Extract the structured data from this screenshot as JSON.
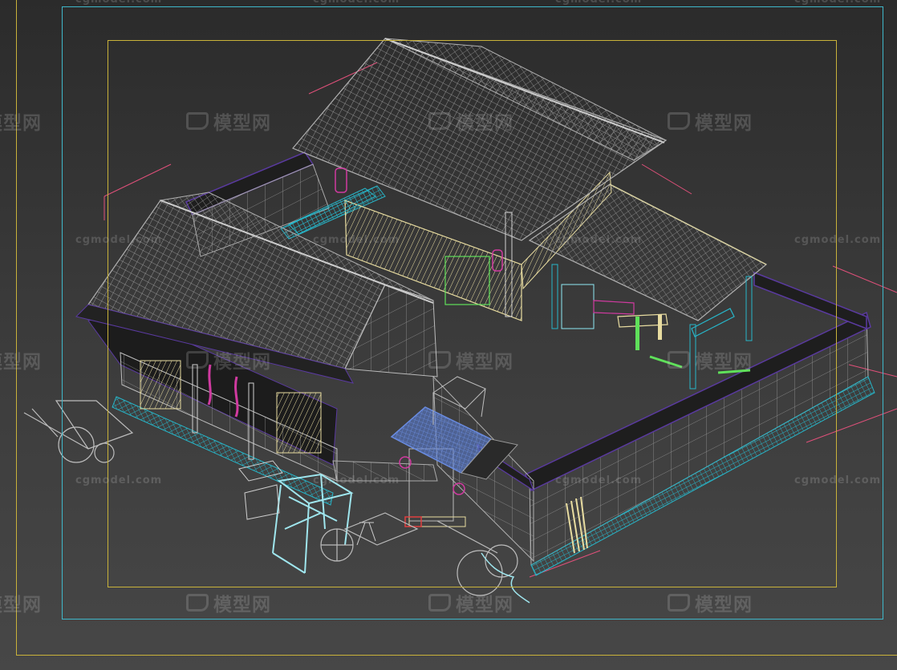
{
  "viewport": {
    "name": "3ds-max-perspective-viewport",
    "view_mode": "wireframe",
    "background": "#3a3a3a"
  },
  "safe_frames": {
    "outer_color": "#c9b23a",
    "safe_color": "#3fb7c9",
    "action_color": "#c9b23a"
  },
  "watermark": {
    "site": "cgmodel.com",
    "brand": "模型网"
  },
  "scene": {
    "wire_colors": {
      "roof": "#9a9a9a",
      "timber": "#e8dca0",
      "wall": "#b8b8b8",
      "base": "#27b6c9",
      "wall_cap": "#5a3aa0",
      "gate_roof": "#5b7fd8",
      "lantern": "#d03aa0",
      "cart": "#bdbdbd",
      "rack": "#9fe6ee",
      "green_parts": "#5fe05a",
      "guide_lines": "#e0507a"
    },
    "icons": [
      "wireframe-courtyard-house",
      "gate",
      "ox-cart",
      "wooden-rack",
      "lantern"
    ]
  }
}
